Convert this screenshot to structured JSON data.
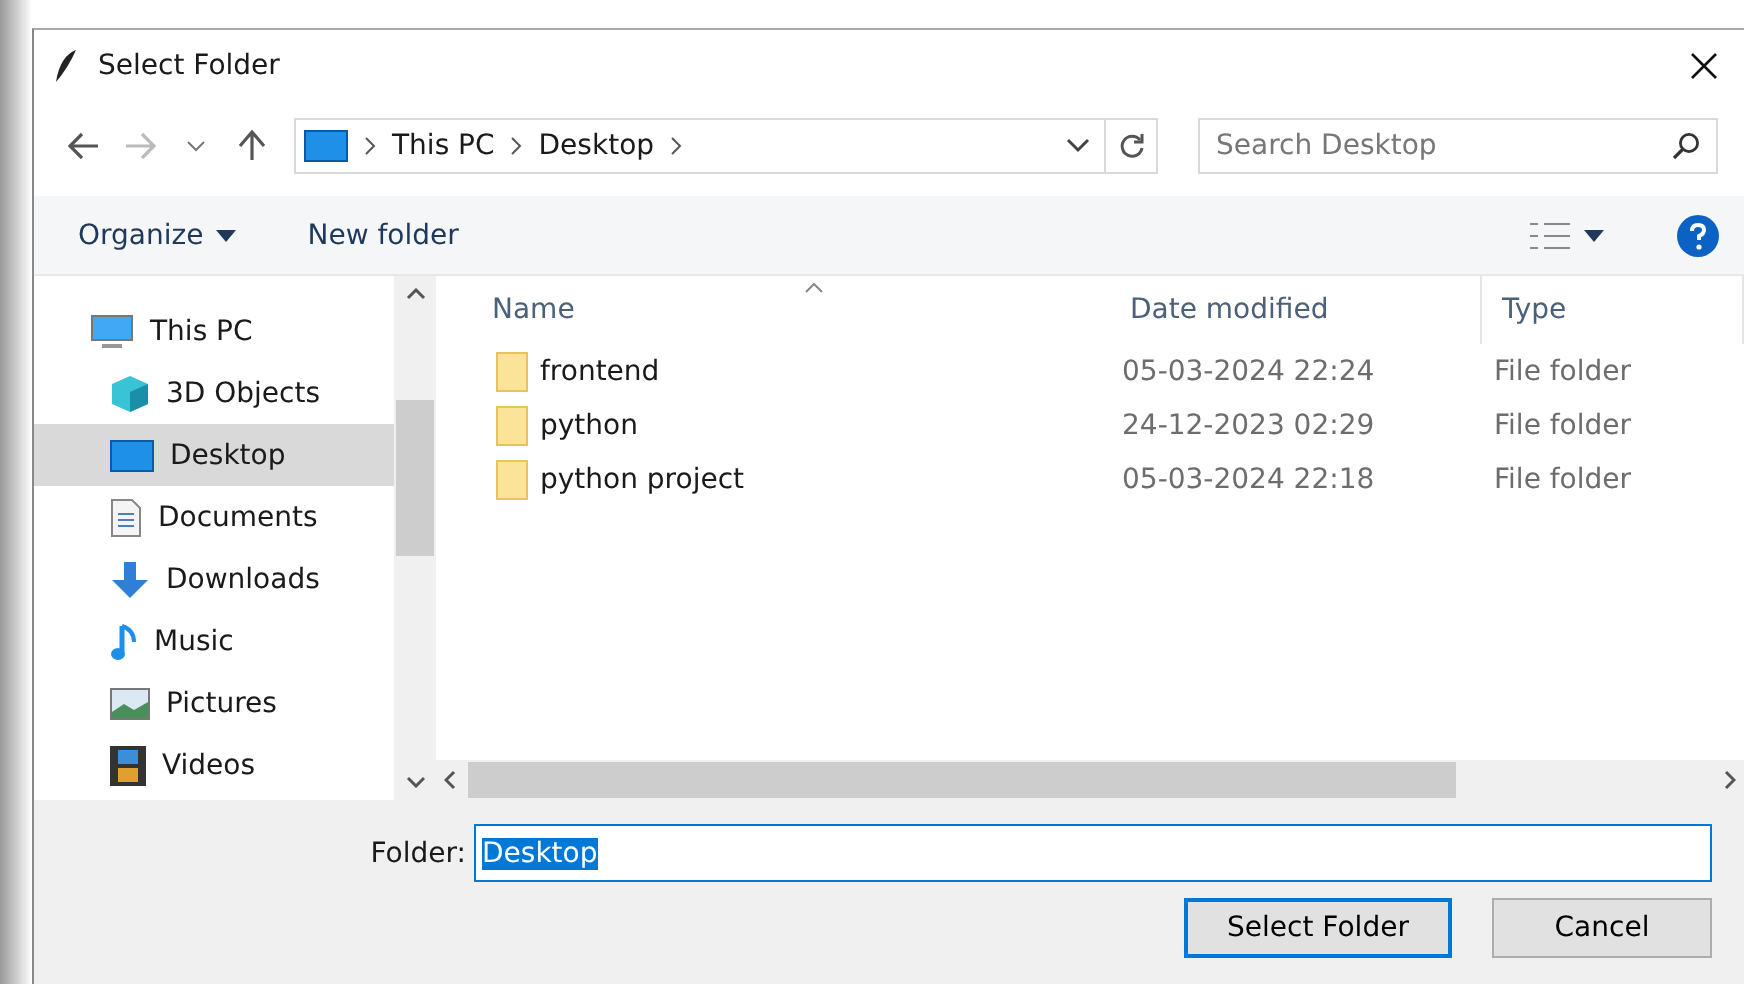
{
  "window": {
    "title": "Select Folder"
  },
  "address": {
    "crumbs": [
      "This PC",
      "Desktop"
    ]
  },
  "search": {
    "placeholder": "Search Desktop"
  },
  "toolbar": {
    "organize": "Organize",
    "new_folder": "New folder"
  },
  "sidebar": {
    "items": [
      {
        "label": "This PC",
        "selected": false,
        "children": [
          {
            "label": "3D Objects",
            "selected": false
          },
          {
            "label": "Desktop",
            "selected": true
          },
          {
            "label": "Documents",
            "selected": false
          },
          {
            "label": "Downloads",
            "selected": false
          },
          {
            "label": "Music",
            "selected": false
          },
          {
            "label": "Pictures",
            "selected": false
          },
          {
            "label": "Videos",
            "selected": false
          }
        ]
      }
    ]
  },
  "table": {
    "columns": [
      "Name",
      "Date modified",
      "Type"
    ],
    "rows": [
      {
        "name": "frontend",
        "date": "05-03-2024 22:24",
        "type": "File folder"
      },
      {
        "name": "python",
        "date": "24-12-2023 02:29",
        "type": "File folder"
      },
      {
        "name": "python project",
        "date": "05-03-2024 22:18",
        "type": "File folder"
      }
    ]
  },
  "folder_field": {
    "label": "Folder:",
    "value": "Desktop"
  },
  "buttons": [
    {
      "label": "Select Folder",
      "default": true
    },
    {
      "label": "Cancel",
      "default": false
    }
  ]
}
